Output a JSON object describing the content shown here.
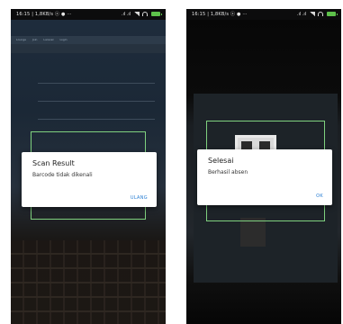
{
  "statusbar": {
    "left_text": "16:15 | 1,8KB/s ⓧ ● ···",
    "right_text": ".ıl .ıl"
  },
  "left_screen": {
    "tabs": [
      "Lounge",
      "Join",
      "Laravel",
      "Login"
    ],
    "dialog": {
      "title": "Scan Result",
      "message": "Barcode tidak dikenali",
      "button": "ULANG"
    }
  },
  "right_screen": {
    "dialog": {
      "title": "Selesai",
      "message": "Berhasil absen",
      "button": "OK"
    }
  },
  "colors": {
    "frame": "#7fd17f",
    "button": "#2a7fd4",
    "battery": "#5ec24b"
  }
}
